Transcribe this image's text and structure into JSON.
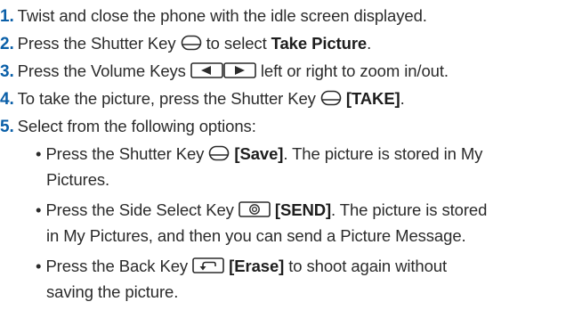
{
  "steps": [
    {
      "num": "1.",
      "text": "Twist and close the phone with the idle screen displayed."
    },
    {
      "num": "2.",
      "pre": "Press the Shutter Key",
      "post": "to select",
      "bold": "Take Picture",
      "end": "."
    },
    {
      "num": "3.",
      "pre": "Press the Volume Keys",
      "post": "left or right to zoom in/out."
    },
    {
      "num": "4.",
      "pre": "To take the picture, press the Shutter Key",
      "bold": "[TAKE]",
      "end": "."
    },
    {
      "num": "5.",
      "text": "Select from the following options:"
    }
  ],
  "options": [
    {
      "bullet": "•",
      "pre": "Press the Shutter Key",
      "bold": "[Save]",
      "line1_end": ". The picture is stored in My",
      "line2": "Pictures."
    },
    {
      "bullet": "•",
      "pre": "Press the Side Select Key",
      "bold": "[SEND]",
      "line1_end": ". The picture is stored",
      "line2": "in My Pictures, and then you can send a Picture Message."
    },
    {
      "bullet": "•",
      "pre": "Press the Back Key",
      "bold": "[Erase]",
      "line1_end": "to shoot again without",
      "line2": "saving the picture."
    }
  ],
  "icons": {
    "shutter": "shutter-key-icon",
    "volume": "volume-keys-icon",
    "side_select": "side-select-key-icon",
    "back": "back-key-icon"
  },
  "colors": {
    "step_number": "#0a5fa8",
    "text": "#2b2b2b"
  }
}
